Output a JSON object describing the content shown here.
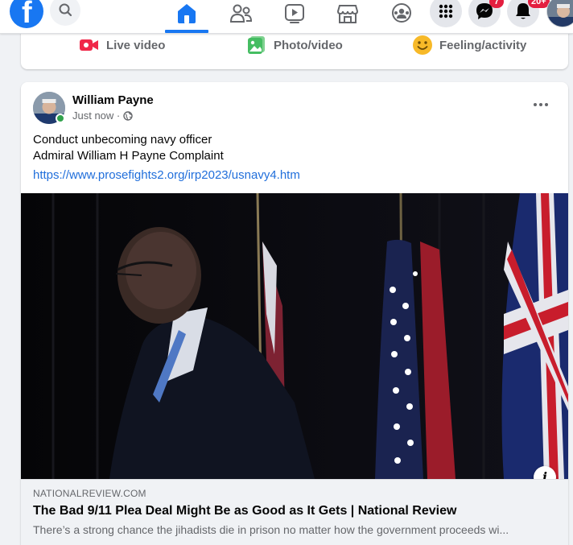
{
  "topbar": {
    "messenger_badge": "7",
    "notifications_badge": "20+"
  },
  "composer": {
    "live_video": "Live video",
    "photo_video": "Photo/video",
    "feeling_activity": "Feeling/activity"
  },
  "post": {
    "author": "William Payne",
    "timestamp": "Just now ·",
    "text_line1": "Conduct unbecoming navy officer",
    "text_line2": "Admiral William H Payne Complaint",
    "link_url": "https://www.prosefights2.org/irp2023/usnavy4.htm",
    "link_preview": {
      "domain": "NATIONALREVIEW.COM",
      "title": "The Bad 9/11 Plea Deal Might Be as Good as It Gets | National Review",
      "description": "There’s a strong chance the jihadists die in prison no matter how the government proceeds wi..."
    }
  },
  "colors": {
    "brand": "#1877f2",
    "link": "#216fdb",
    "badge": "#e41e3f",
    "live": "#f02849",
    "photo": "#45bd62",
    "feeling": "#f7b928"
  }
}
